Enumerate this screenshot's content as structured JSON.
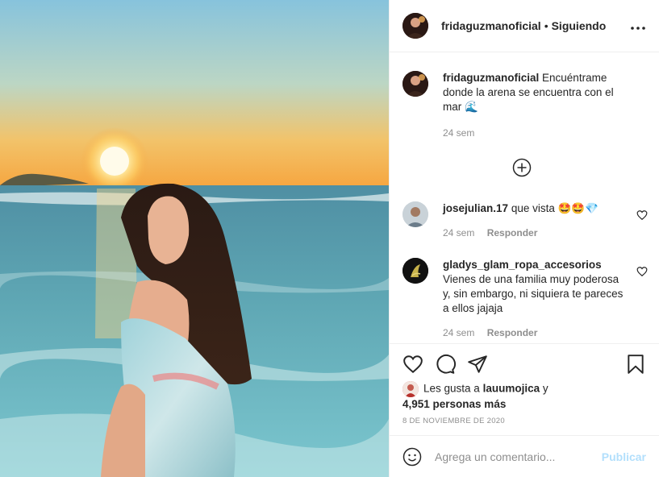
{
  "header": {
    "username": "fridaguzmanoficial",
    "separator": "•",
    "follow_status": "Siguiendo",
    "more_icon": "more-horizontal-icon"
  },
  "caption": {
    "username": "fridaguzmanoficial",
    "text": "Encuéntrame donde la arena se encuentra con el mar 🌊",
    "time": "24 sem"
  },
  "load_more_icon": "plus-circle-icon",
  "comments": [
    {
      "username": "josejulian.17",
      "text": "que vista 🤩🤩💎",
      "time": "24 sem",
      "reply": "Responder"
    },
    {
      "username": "gladys_glam_ropa_accesorios",
      "text": "Vienes de una familia muy poderosa y, sin embargo, ni siquiera te pareces a ellos jajaja",
      "time": "24 sem",
      "reply": "Responder"
    }
  ],
  "likes": {
    "prefix": "Les gusta a",
    "user": "lauumojica",
    "joiner": "y",
    "others": "4,951 personas más"
  },
  "date": "8 DE NOVIEMBRE DE 2020",
  "composer": {
    "placeholder": "Agrega un comentario...",
    "publish_label": "Publicar"
  }
}
